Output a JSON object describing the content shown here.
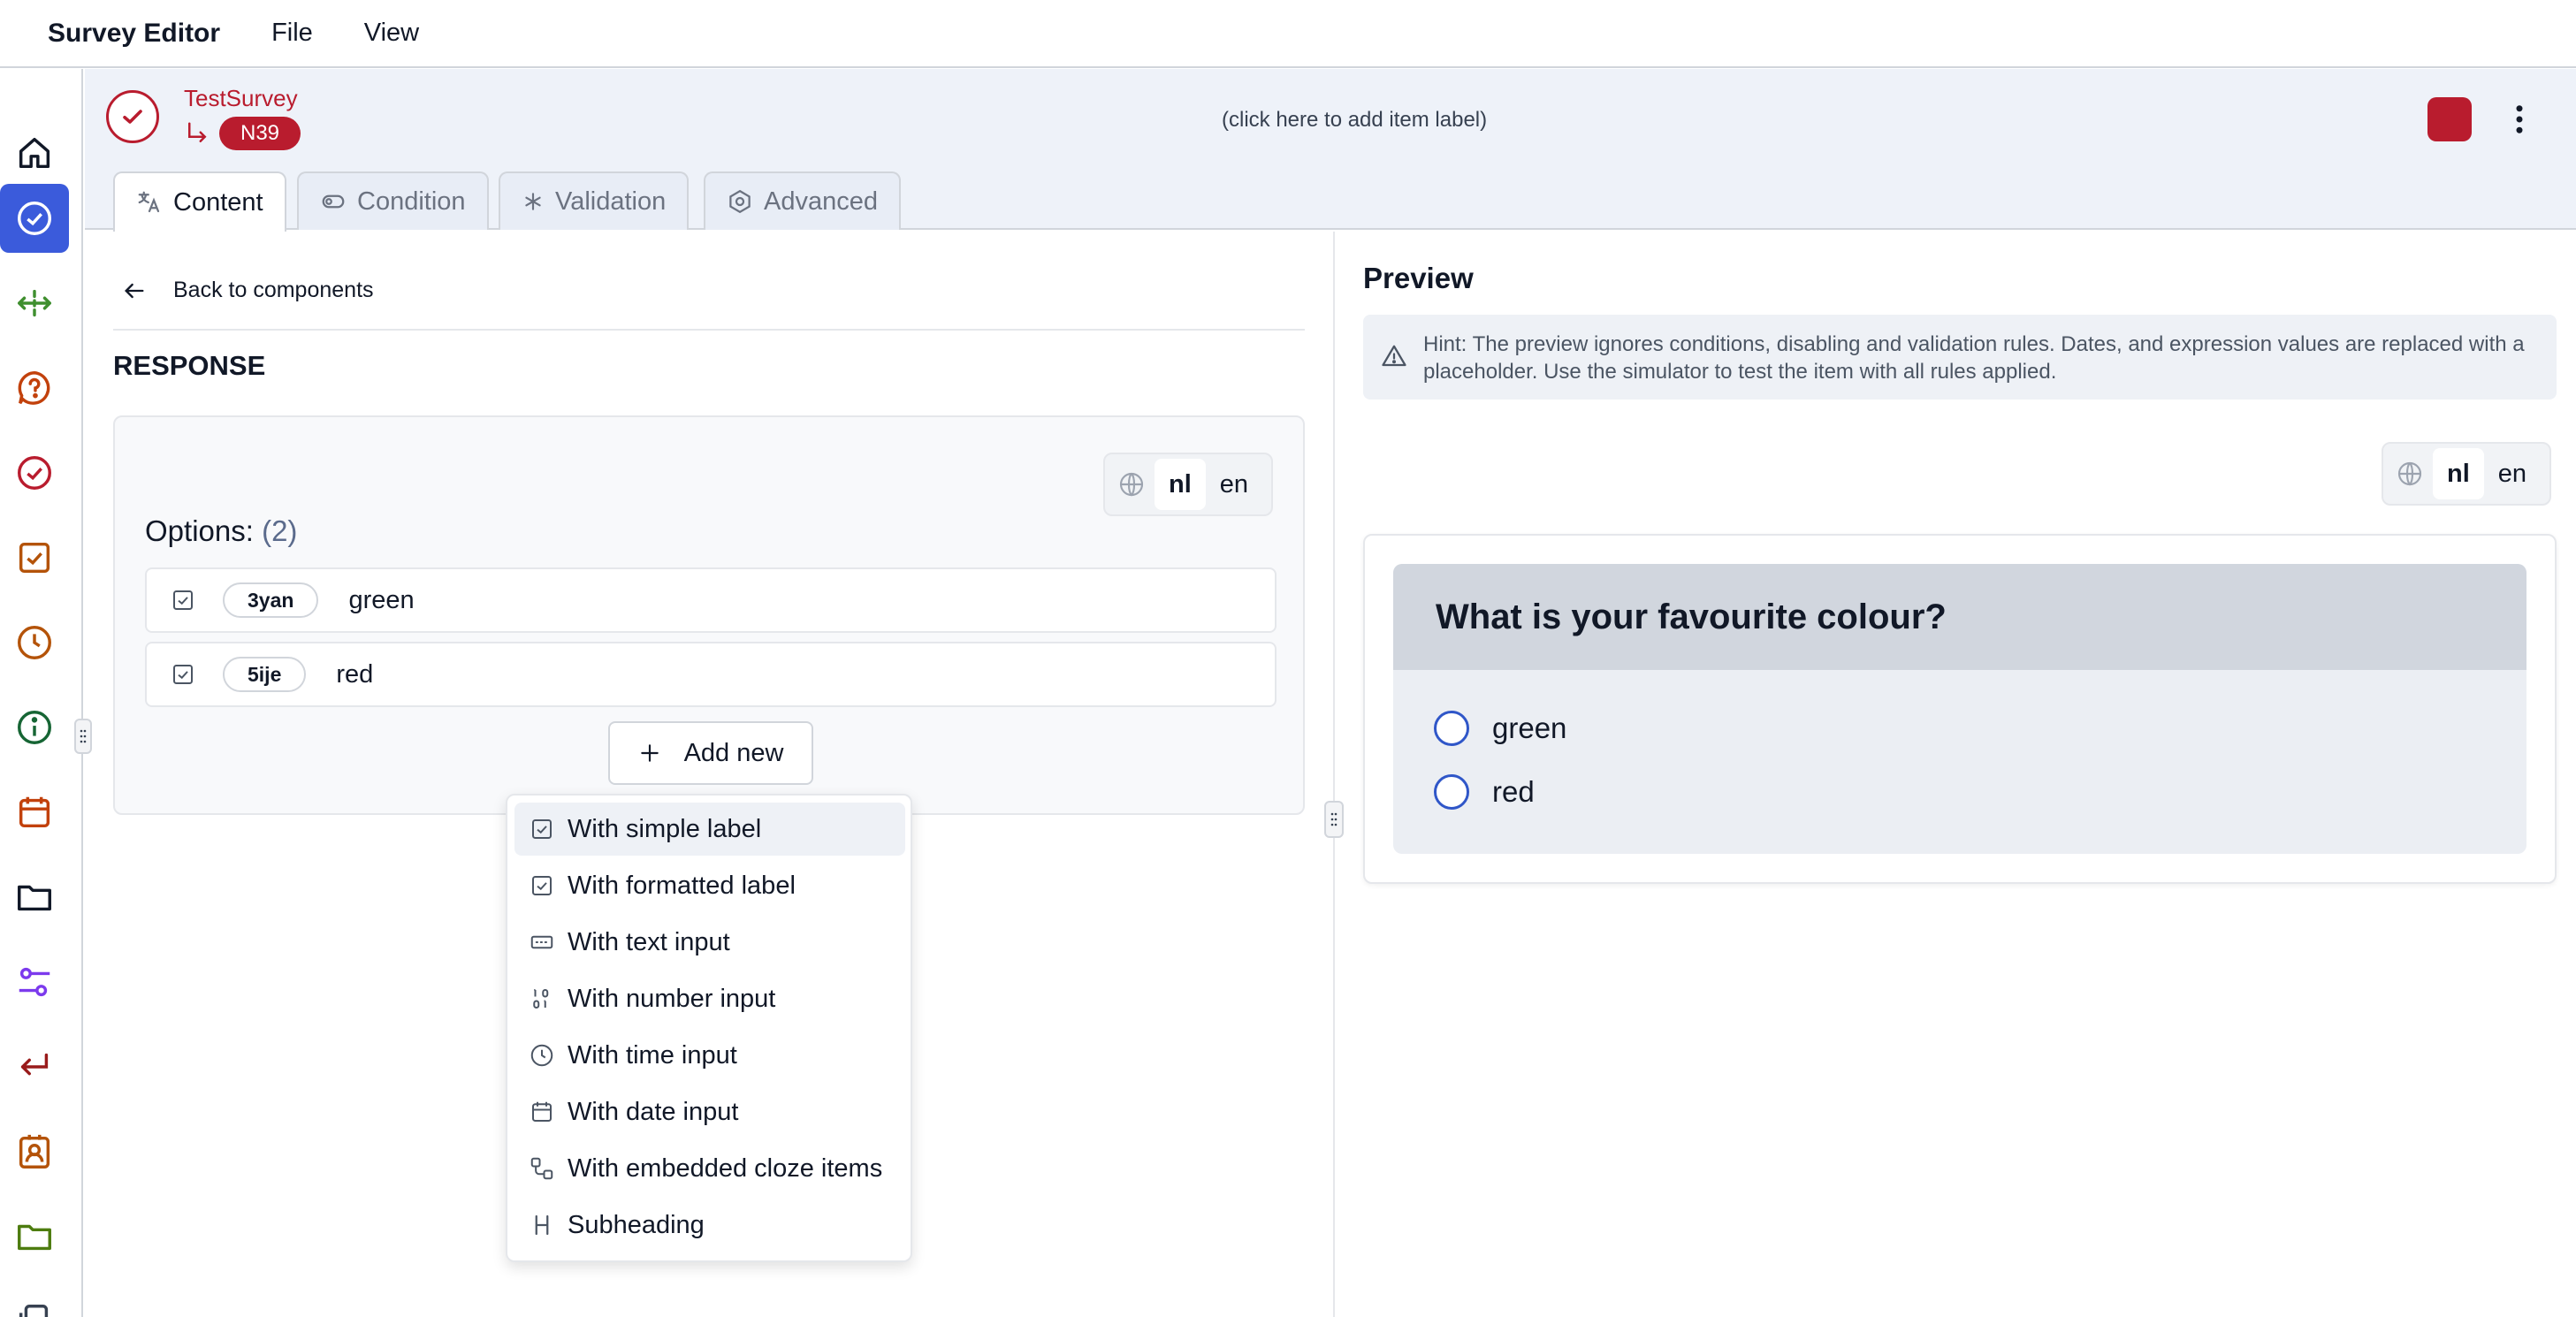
{
  "app": {
    "title": "Survey Editor",
    "menu": [
      "File",
      "View"
    ]
  },
  "rail": {
    "icons": [
      {
        "name": "home-icon",
        "color": "#111827"
      },
      {
        "name": "check-circle-icon",
        "color": "#ffffff",
        "active": true
      },
      {
        "name": "move-icon",
        "color": "#3f8f2f"
      },
      {
        "name": "help-icon",
        "color": "#c2410c"
      },
      {
        "name": "check-circle-icon",
        "color": "#b91c2e"
      },
      {
        "name": "checkbox-icon",
        "color": "#b45309"
      },
      {
        "name": "clock-icon",
        "color": "#b45309"
      },
      {
        "name": "info-icon",
        "color": "#166534"
      },
      {
        "name": "calendar-icon",
        "color": "#c2410c"
      },
      {
        "name": "folder-icon",
        "color": "#111827"
      },
      {
        "name": "sliders-icon",
        "color": "#7c3aed"
      },
      {
        "name": "return-icon",
        "color": "#991b1b"
      },
      {
        "name": "contact-icon",
        "color": "#b45309"
      },
      {
        "name": "folder-icon",
        "color": "#4d7c0f"
      }
    ]
  },
  "item": {
    "survey_name": "TestSurvey",
    "key": "N39",
    "label_placeholder": "(click here to add item label)",
    "accent_color": "#b91c2e"
  },
  "tabs": [
    {
      "label": "Content",
      "icon": "translate-icon",
      "active": true
    },
    {
      "label": "Condition",
      "icon": "toggle-icon"
    },
    {
      "label": "Validation",
      "icon": "asterisk-icon"
    },
    {
      "label": "Advanced",
      "icon": "settings-icon"
    }
  ],
  "editor": {
    "back_label": "Back to components",
    "section_title": "RESPONSE",
    "languages": [
      "nl",
      "en"
    ],
    "selected_language": "nl",
    "options_label": "Options:",
    "options_count": "(2)",
    "options": [
      {
        "key": "3yan",
        "label": "green"
      },
      {
        "key": "5ije",
        "label": "red"
      }
    ],
    "add_new_label": "Add new",
    "add_menu": [
      {
        "label": "With simple label",
        "icon": "checkbox-icon"
      },
      {
        "label": "With formatted label",
        "icon": "checkbox-icon"
      },
      {
        "label": "With text input",
        "icon": "text-input-icon"
      },
      {
        "label": "With number input",
        "icon": "number-input-icon"
      },
      {
        "label": "With time input",
        "icon": "clock-icon"
      },
      {
        "label": "With date input",
        "icon": "calendar-icon"
      },
      {
        "label": "With embedded cloze items",
        "icon": "cloze-icon"
      },
      {
        "label": "Subheading",
        "icon": "heading-icon"
      }
    ]
  },
  "preview": {
    "title": "Preview",
    "hint": "Hint: The preview ignores conditions, disabling and validation rules. Dates, and expression values are replaced with a placeholder. Use the simulator to test the item with all rules applied.",
    "languages": [
      "nl",
      "en"
    ],
    "selected_language": "nl",
    "question": "What is your favourite colour?",
    "choices": [
      "green",
      "red"
    ]
  }
}
